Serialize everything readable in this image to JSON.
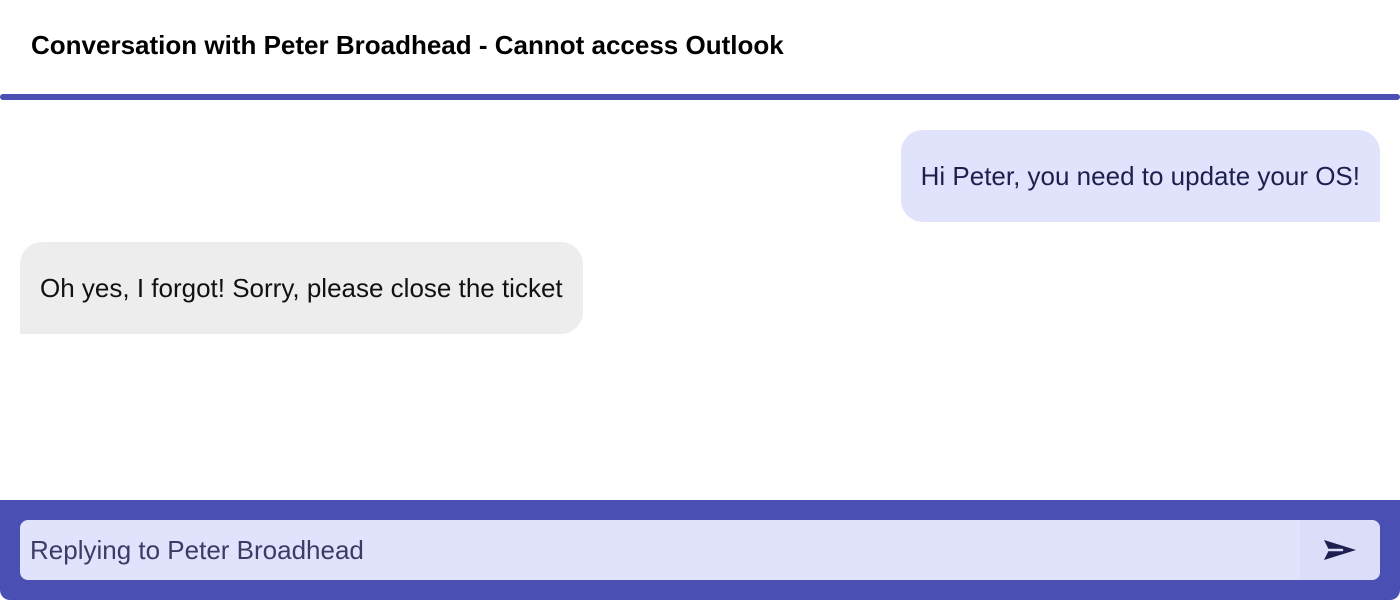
{
  "conversation": {
    "title": "Conversation with Peter Broadhead - Cannot access Outlook"
  },
  "messages": [
    {
      "direction": "outgoing",
      "text": "Hi Peter, you need to update your OS!"
    },
    {
      "direction": "incoming",
      "text": "Oh yes, I forgot! Sorry, please close the ticket"
    }
  ],
  "composer": {
    "placeholder": "Replying to Peter Broadhead",
    "value": "",
    "send_icon": "send-icon"
  },
  "colors": {
    "accent": "#4a50b3",
    "outgoing_bubble": "#e1e2fb",
    "incoming_bubble": "#ededed",
    "input_background": "#e1e2fb"
  }
}
